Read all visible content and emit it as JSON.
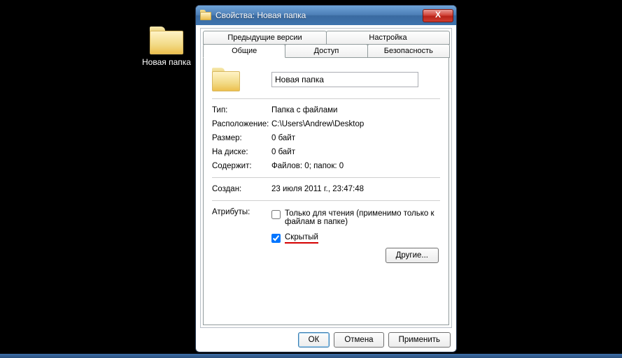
{
  "desktop": {
    "icon_label": "Новая папка"
  },
  "window": {
    "title": "Свойства: Новая папка",
    "close_glyph": "X"
  },
  "tabs": {
    "row1": [
      "Предыдущие версии",
      "Настройка"
    ],
    "row2": [
      "Общие",
      "Доступ",
      "Безопасность"
    ],
    "active": "Общие"
  },
  "general": {
    "name_value": "Новая папка",
    "labels": {
      "type": "Тип:",
      "location": "Расположение:",
      "size": "Размер:",
      "on_disk": "На диске:",
      "contains": "Содержит:",
      "created": "Создан:",
      "attributes": "Атрибуты:"
    },
    "values": {
      "type": "Папка с файлами",
      "location": "C:\\Users\\Andrew\\Desktop",
      "size": "0 байт",
      "on_disk": "0 байт",
      "contains": "Файлов: 0; папок: 0",
      "created": "23 июля 2011 г., 23:47:48"
    },
    "readonly_label": "Только для чтения (применимо только к файлам в папке)",
    "hidden_label": "Скрытый",
    "other_button": "Другие..."
  },
  "buttons": {
    "ok": "ОК",
    "cancel": "Отмена",
    "apply": "Применить"
  }
}
